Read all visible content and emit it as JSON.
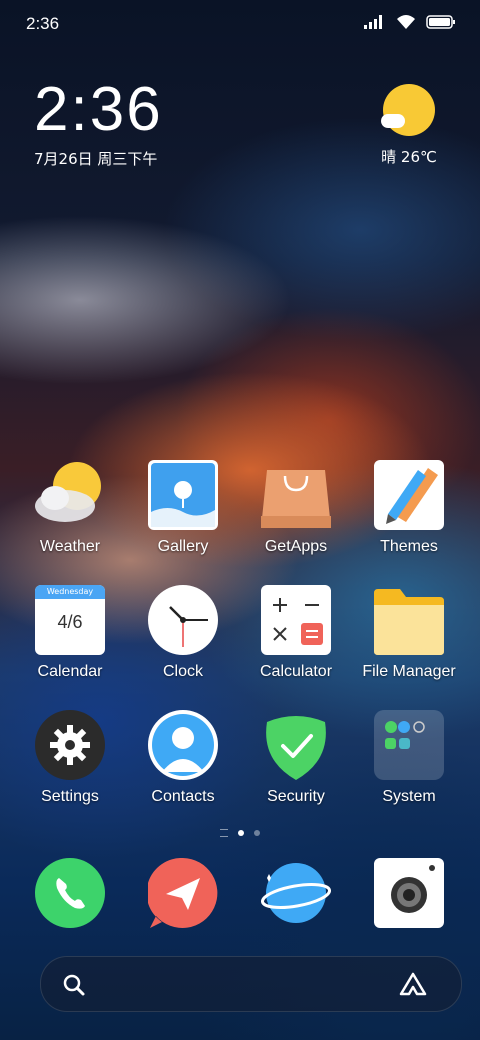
{
  "status_bar": {
    "time": "2:36"
  },
  "clock_widget": {
    "time": "2:36",
    "date": "7月26日 周三下午"
  },
  "weather_widget": {
    "temp": "晴 26℃"
  },
  "apps": [
    {
      "label": "Weather"
    },
    {
      "label": "Gallery"
    },
    {
      "label": "GetApps"
    },
    {
      "label": "Themes"
    },
    {
      "label": "Calendar",
      "calendar_header": "Wednesday",
      "calendar_date": "4/6"
    },
    {
      "label": "Clock"
    },
    {
      "label": "Calculator"
    },
    {
      "label": "File Manager"
    },
    {
      "label": "Settings"
    },
    {
      "label": "Contacts"
    },
    {
      "label": "Security"
    },
    {
      "label": "System"
    }
  ],
  "dock": [
    {
      "name": "phone"
    },
    {
      "name": "messaging"
    },
    {
      "name": "browser"
    },
    {
      "name": "camera"
    }
  ],
  "colors": {
    "weather_sun": "#f8c935",
    "phone_green": "#3dd36b",
    "message_red": "#f06359",
    "browser_blue": "#3fa9f5",
    "security_green": "#4cd365"
  }
}
